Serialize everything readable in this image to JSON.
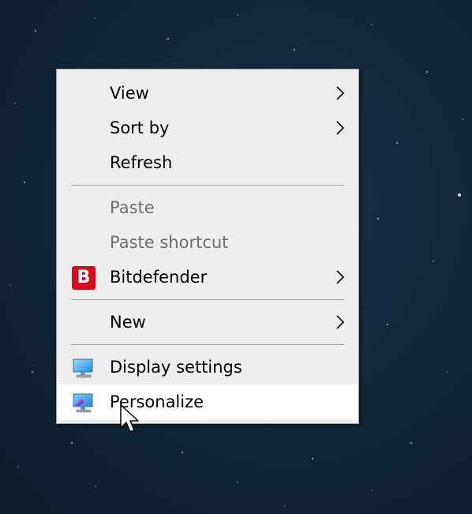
{
  "context_menu": {
    "items": [
      {
        "label": "View",
        "has_submenu": true,
        "disabled": false
      },
      {
        "label": "Sort by",
        "has_submenu": true,
        "disabled": false
      },
      {
        "label": "Refresh",
        "has_submenu": false,
        "disabled": false
      },
      {
        "label": "Paste",
        "has_submenu": false,
        "disabled": true
      },
      {
        "label": "Paste shortcut",
        "has_submenu": false,
        "disabled": true
      },
      {
        "label": "Bitdefender",
        "has_submenu": true,
        "disabled": false,
        "icon": "bitdefender-icon",
        "icon_letter": "B",
        "icon_color": "#d50d1d"
      },
      {
        "label": "New",
        "has_submenu": true,
        "disabled": false
      },
      {
        "label": "Display settings",
        "has_submenu": false,
        "disabled": false,
        "icon": "display-settings-icon"
      },
      {
        "label": "Personalize",
        "has_submenu": false,
        "disabled": false,
        "icon": "personalize-icon",
        "highlighted": true
      }
    ]
  },
  "colors": {
    "menu_background": "#eeeeee",
    "hover_background": "#ffffff",
    "disabled_text": "#6d6d6d",
    "separator": "#a0a0a0",
    "desktop_background": "#0f2538"
  }
}
